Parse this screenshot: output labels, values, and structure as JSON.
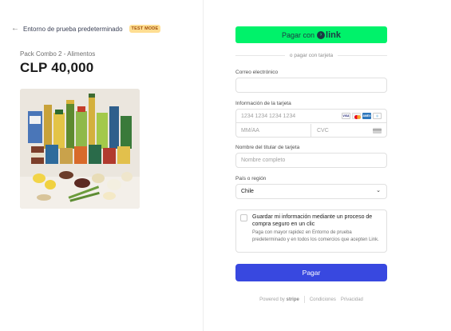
{
  "merchant": {
    "back_icon": "arrow-left-icon",
    "name": "Entorno de prueba predeterminado",
    "badge": "TEST MODE"
  },
  "product": {
    "name": "Pack Combo 2 - Alimentos",
    "price": "CLP 40,000"
  },
  "link": {
    "button_prefix": "Pagar con",
    "logo_text": "link"
  },
  "divider_text": "o pagar con tarjeta",
  "email": {
    "label": "Correo electrónico",
    "value": ""
  },
  "card": {
    "label": "Información de la tarjeta",
    "number_placeholder": "1234 1234 1234 1234",
    "expiry_placeholder": "MM/AA",
    "cvc_placeholder": "CVC",
    "brands": [
      "VISA",
      "mastercard",
      "AMEX",
      "diners"
    ]
  },
  "holder": {
    "label": "Nombre del titular de tarjeta",
    "placeholder": "Nombre completo"
  },
  "country": {
    "label": "País o región",
    "value": "Chile"
  },
  "save_info": {
    "title": "Guardar mi información mediante un proceso de compra seguro en un clic",
    "description": "Paga con mayor rapidez en Entorno de prueba predeterminado y en todos los comercios que acepten Link."
  },
  "pay_button": "Pagar",
  "footer": {
    "powered_by": "Powered by",
    "brand": "stripe",
    "terms": "Condiciones",
    "privacy": "Privacidad"
  },
  "colors": {
    "link_green": "#00f26a",
    "pay_blue": "#3848e0",
    "badge_bg": "#ffde92",
    "badge_text": "#a04f0b"
  }
}
